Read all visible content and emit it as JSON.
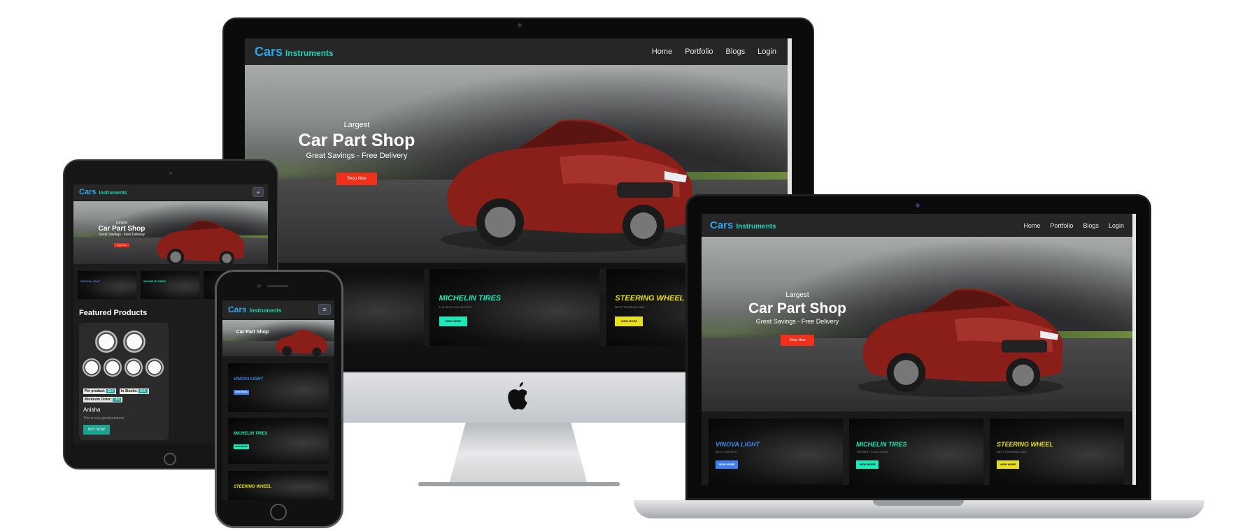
{
  "brand": {
    "name": "Cars",
    "suffix": "Instruments"
  },
  "nav": [
    "Home",
    "Portfolio",
    "Blogs",
    "Login"
  ],
  "hero": {
    "small": "Largest",
    "title": "Car Part Shop",
    "tagline": "Great Savings - Free Delivery",
    "button": "Shop Now"
  },
  "categories": [
    {
      "title": "VINOVA LIGHT",
      "sub": "BEST LIGHTING",
      "button": "VIEW MORE",
      "color": "#3f8cf0"
    },
    {
      "title": "MICHELIN TIRES",
      "sub": "THE BEST COLLECTION",
      "button": "VIEW MORE",
      "color": "#1de8b8"
    },
    {
      "title": "STEERING WHEEL",
      "sub": "BEST TRENDING 2020",
      "button": "VIEW MORE",
      "color": "#e8e01a"
    }
  ],
  "featured": {
    "title": "Featured Products",
    "per_product_label": "Per product:",
    "per_product_value": "$50",
    "stock_label": "In Stocks:",
    "stock_value": "860",
    "min_order_label": "Minimum Order:",
    "min_order_value": "100",
    "name": "Anisha",
    "desc": "This is very good products",
    "buy": "BUY NOW"
  },
  "colors": {
    "accent": "#2fa6e8",
    "teal": "#22d3b5",
    "shop": "#f0301b"
  },
  "icons": {
    "menu": "hamburger-icon",
    "apple": "apple-logo-icon"
  }
}
